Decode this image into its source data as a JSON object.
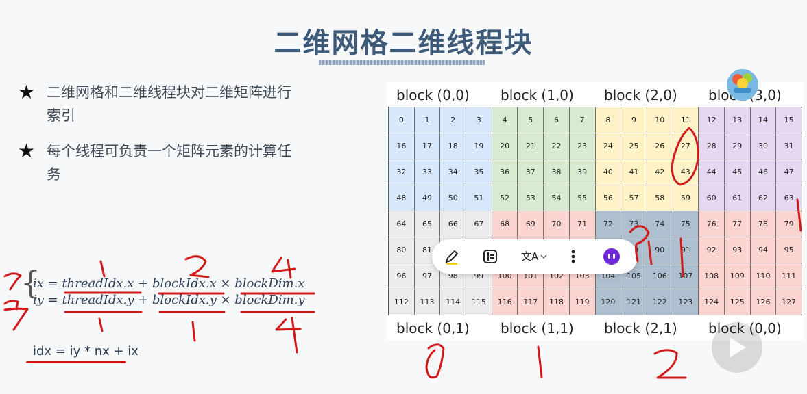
{
  "slide": {
    "title": "二维网格二维线程块",
    "bullets": [
      "二维网格和二维线程块对二维矩阵进行索引",
      "每个线程可负责一个矩阵元素的计算任务"
    ],
    "formula_x": "ix = threadIdx.x + blockIdx.x × blockDim.x",
    "formula_y": "iy = threadIdx.y + blockIdx.y × blockDim.y",
    "idx_formula": "idx = iy * nx + ix"
  },
  "figure": {
    "top_labels": [
      "block (0,0)",
      "block (1,0)",
      "block (2,0)",
      "block (3,0)"
    ],
    "bottom_labels": [
      "block (0,1)",
      "block (1,1)",
      "block (2,1)",
      "block (0,0)"
    ],
    "block_colors": {
      "b00": "#d8e8fb",
      "b10": "#d8ebd0",
      "b20": "#fff2c7",
      "b30": "#e4d7ef",
      "b01": "#ececec",
      "b11": "#fbd4d0",
      "b21": "#aebfd0",
      "b31": "#fbd4d0"
    }
  },
  "toolbar": {
    "icons": [
      "pen-icon",
      "panel-icon",
      "translate-icon",
      "more-icon",
      "assistant-icon"
    ]
  },
  "annotations": {
    "handwritten": [
      "1",
      "2",
      "4",
      "1",
      "1",
      "4",
      "0",
      "1",
      "2"
    ]
  }
}
